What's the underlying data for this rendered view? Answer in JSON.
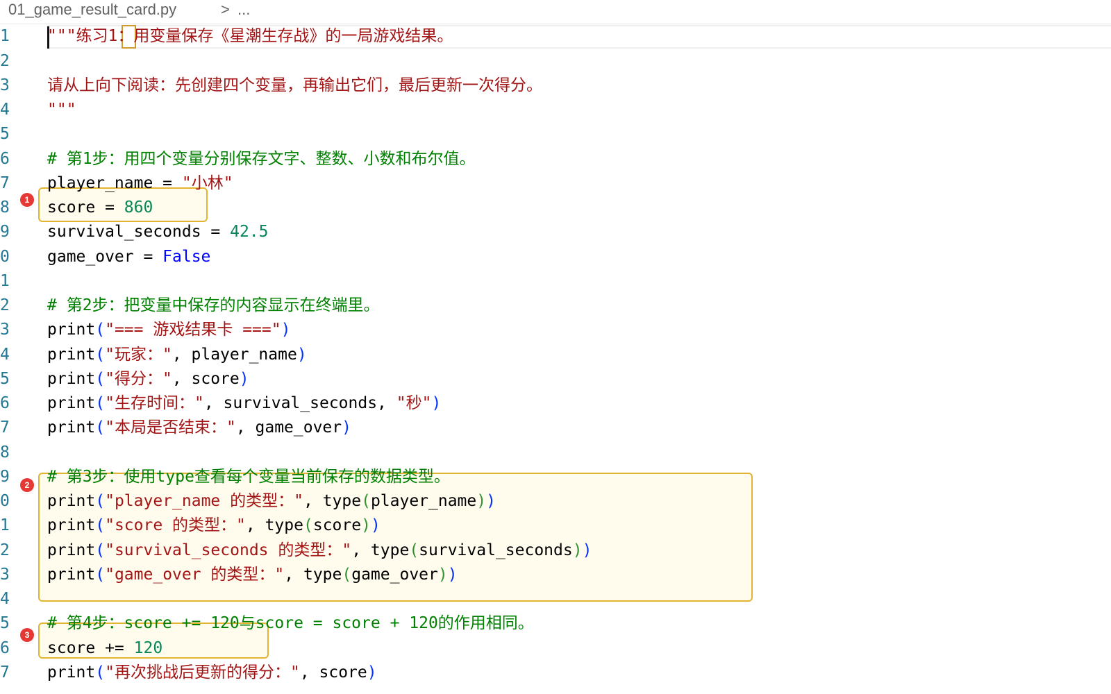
{
  "breadcrumb": {
    "file": "01_game_result_card.py",
    "separator": ">",
    "more": "..."
  },
  "gutter": [
    "1",
    "2",
    "3",
    "4",
    "5",
    "6",
    "7",
    "8",
    "9",
    "0",
    "1",
    "2",
    "3",
    "4",
    "5",
    "6",
    "7",
    "8",
    "9",
    "0",
    "1",
    "2",
    "3",
    "4",
    "5",
    "6",
    "7"
  ],
  "code": {
    "l1": {
      "a": "\"\"\"练习1",
      "b": "：",
      "c": "用变量保存《星潮生存战》的一局游戏结果。"
    },
    "l3": "请从上向下阅读：先创建四个变量，再输出它们，最后更新一次得分。",
    "l4": "\"\"\"",
    "l6": "# 第1步：用四个变量分别保存文字、整数、小数和布尔值。",
    "l7": {
      "a": "player_name = ",
      "b": "\"小林\""
    },
    "l8": {
      "a": "score = ",
      "b": "860"
    },
    "l9": {
      "a": "survival_seconds = ",
      "b": "42.5"
    },
    "l10": {
      "a": "game_over = ",
      "b": "False"
    },
    "l12": "# 第2步：把变量中保存的内容显示在终端里。",
    "l13": {
      "a": "print",
      "b": "(",
      "c": "\"=== 游戏结果卡 ===\"",
      "d": ")"
    },
    "l14": {
      "a": "print",
      "b": "(",
      "c": "\"玩家：\"",
      "d": ", player_name",
      "e": ")"
    },
    "l15": {
      "a": "print",
      "b": "(",
      "c": "\"得分：\"",
      "d": ", score",
      "e": ")"
    },
    "l16": {
      "a": "print",
      "b": "(",
      "c": "\"生存时间：\"",
      "d": ", survival_seconds, ",
      "e": "\"秒\"",
      "f": ")"
    },
    "l17": {
      "a": "print",
      "b": "(",
      "c": "\"本局是否结束：\"",
      "d": ", game_over",
      "e": ")"
    },
    "l19": "# 第3步：使用type查看每个变量当前保存的数据类型。",
    "l20": {
      "a": "print",
      "b": "(",
      "c": "\"player_name 的类型：\"",
      "d": ", type",
      "e": "(",
      "f": "player_name",
      "g": ")",
      "h": ")"
    },
    "l21": {
      "a": "print",
      "b": "(",
      "c": "\"score 的类型：\"",
      "d": ", type",
      "e": "(",
      "f": "score",
      "g": ")",
      "h": ")"
    },
    "l22": {
      "a": "print",
      "b": "(",
      "c": "\"survival_seconds 的类型：\"",
      "d": ", type",
      "e": "(",
      "f": "survival_seconds",
      "g": ")",
      "h": ")"
    },
    "l23": {
      "a": "print",
      "b": "(",
      "c": "\"game_over 的类型：\"",
      "d": ", type",
      "e": "(",
      "f": "game_over",
      "g": ")",
      "h": ")"
    },
    "l25": "# 第4步：score += 120与score = score + 120的作用相同。",
    "l26": {
      "a": "score += ",
      "b": "120"
    },
    "l27": {
      "a": "print",
      "b": "(",
      "c": "\"再次挑战后更新的得分：\"",
      "d": ", score",
      "e": ")"
    }
  },
  "badges": [
    "1",
    "2",
    "3"
  ],
  "colors": {
    "string": "#a31515",
    "comment": "#008000",
    "number": "#098658",
    "keyword": "#0000ff",
    "line_number": "#237893",
    "highlight_border": "#e2b432",
    "badge": "#e53935"
  }
}
